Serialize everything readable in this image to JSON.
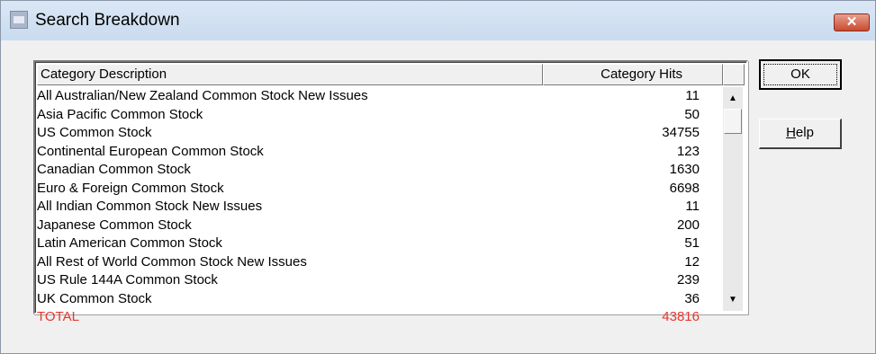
{
  "window": {
    "title": "Search Breakdown",
    "close_glyph": "✕"
  },
  "table": {
    "columns": [
      "Category Description",
      "Category Hits"
    ],
    "rows": [
      {
        "description": "All Australian/New Zealand Common Stock New Issues",
        "hits": "11"
      },
      {
        "description": "Asia Pacific Common Stock",
        "hits": "50"
      },
      {
        "description": "US Common Stock",
        "hits": "34755"
      },
      {
        "description": "Continental European Common Stock",
        "hits": "123"
      },
      {
        "description": "Canadian Common Stock",
        "hits": "1630"
      },
      {
        "description": "Euro & Foreign Common Stock",
        "hits": "6698"
      },
      {
        "description": "All Indian Common Stock New Issues",
        "hits": "11"
      },
      {
        "description": "Japanese Common Stock",
        "hits": "200"
      },
      {
        "description": "Latin American Common Stock",
        "hits": "51"
      },
      {
        "description": "All Rest of World Common Stock New Issues",
        "hits": "12"
      },
      {
        "description": "US Rule 144A Common Stock",
        "hits": "239"
      },
      {
        "description": "UK Common Stock",
        "hits": "36"
      },
      {
        "description": "TOTAL",
        "hits": "43816"
      }
    ]
  },
  "scrollbar": {
    "up_glyph": "▲",
    "down_glyph": "▼"
  },
  "buttons": {
    "ok": "OK",
    "help_accel": "H",
    "help_rest": "elp"
  },
  "colors": {
    "total_row": "#e8362d"
  }
}
